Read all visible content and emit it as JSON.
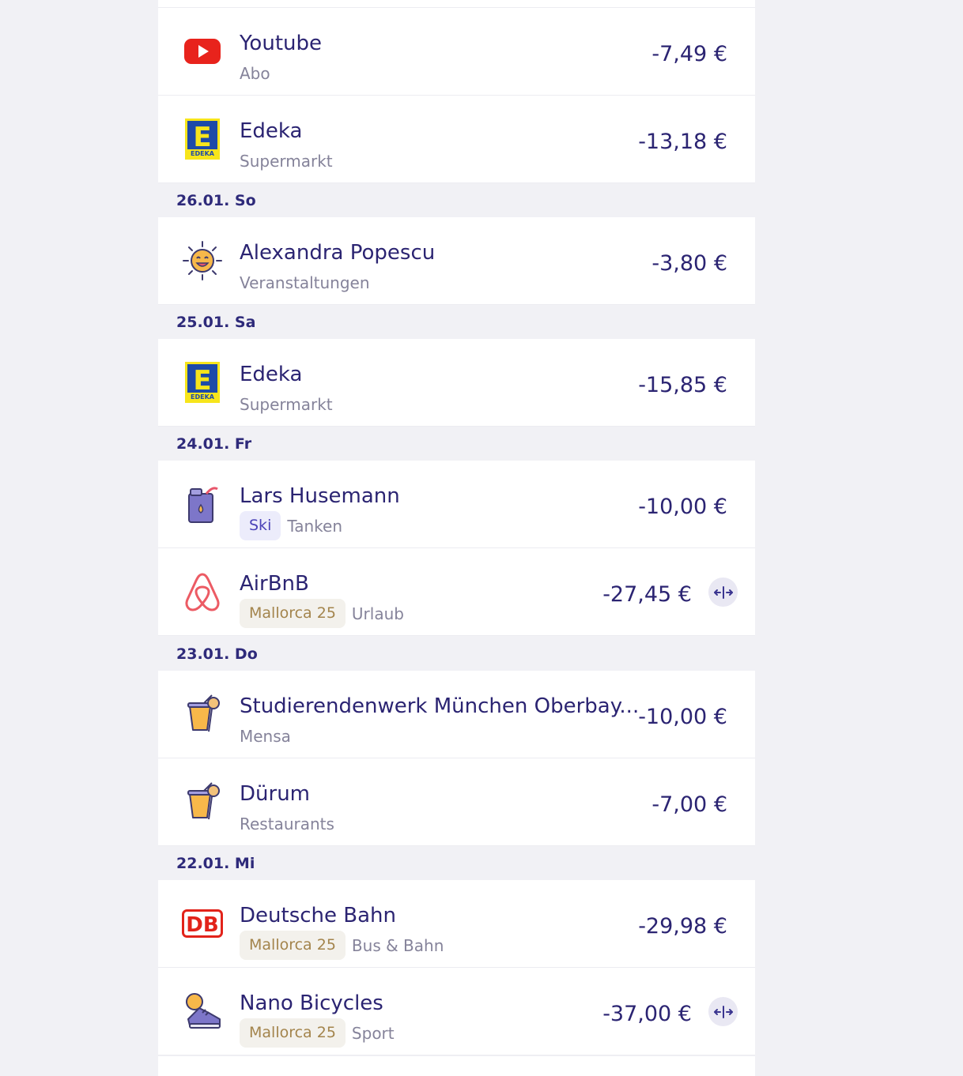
{
  "days": [
    {
      "label": "26.01. So"
    },
    {
      "label": "25.01. Sa"
    },
    {
      "label": "24.01. Fr"
    },
    {
      "label": "23.01. Do"
    },
    {
      "label": "22.01. Mi"
    }
  ],
  "transactions": [
    {
      "name": "Youtube",
      "category": "Abo",
      "amount": "-7,49 €",
      "icon": "youtube-logo"
    },
    {
      "name": "Edeka",
      "category": "Supermarkt",
      "amount": "-13,18 €",
      "icon": "edeka-logo",
      "logo_text": "E",
      "logo_subtext": "EDEKA"
    },
    {
      "name": "Alexandra Popescu",
      "category": "Veranstaltungen",
      "amount": "-3,80 €",
      "icon": "sun-smiley-icon"
    },
    {
      "name": "Edeka",
      "category": "Supermarkt",
      "amount": "-15,85 €",
      "icon": "edeka-logo",
      "logo_text": "E",
      "logo_subtext": "EDEKA"
    },
    {
      "name": "Lars Husemann",
      "tag": "Ski",
      "category": "Tanken",
      "amount": "-10,00 €",
      "icon": "fuel-can-icon"
    },
    {
      "name": "AirBnB",
      "tag": "Mallorca 25",
      "category": "Urlaub",
      "amount": "-27,45 €",
      "icon": "airbnb-logo",
      "split_icon": "split-icon"
    },
    {
      "name": "Studierendenwerk München Oberbay...",
      "category": "Mensa",
      "amount": "-10,00 €",
      "icon": "drink-cup-icon"
    },
    {
      "name": "Dürum",
      "category": "Restaurants",
      "amount": "-7,00 €",
      "icon": "drink-cup-icon"
    },
    {
      "name": "Deutsche Bahn",
      "tag": "Mallorca 25",
      "category": "Bus & Bahn",
      "amount": "-29,98 €",
      "icon": "db-logo",
      "logo_text": "DB"
    },
    {
      "name": "Nano Bicycles",
      "tag": "Mallorca 25",
      "category": "Sport",
      "amount": "-37,00 €",
      "icon": "sneaker-icon",
      "split_icon": "split-icon"
    }
  ]
}
